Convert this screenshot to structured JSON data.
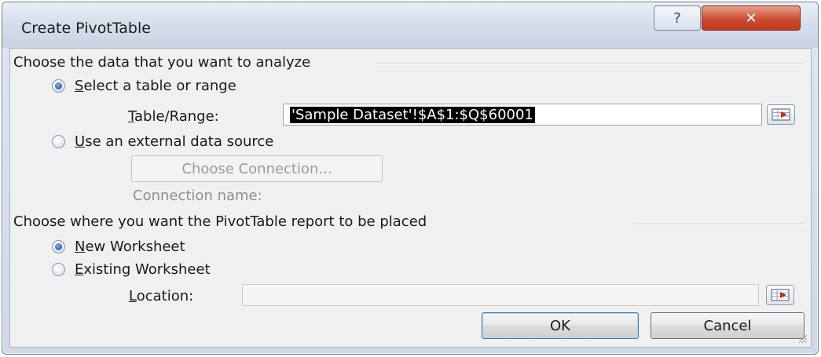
{
  "window": {
    "title": "Create PivotTable",
    "help_label": "?",
    "close_label": "✕"
  },
  "analyze_group": {
    "label": "Choose the data that you want to analyze",
    "select_table": {
      "label_accel": "S",
      "label_rest": "elect a table or range",
      "checked": true
    },
    "table_range": {
      "label_accel": "T",
      "label_rest": "able/Range:",
      "value": "'Sample Dataset'!$A$1:$Q$60001"
    },
    "external_source": {
      "label_accel": "U",
      "label_rest": "se an external data source",
      "checked": false
    },
    "choose_connection_label": "Choose Connection...",
    "connection_name_label": "Connection name:"
  },
  "placement_group": {
    "label": "Choose where you want the PivotTable report to be placed",
    "new_worksheet": {
      "label_accel": "N",
      "label_rest": "ew Worksheet",
      "checked": true
    },
    "existing_worksheet": {
      "label_accel": "E",
      "label_rest": "xisting Worksheet",
      "checked": false
    },
    "location": {
      "label_accel": "L",
      "label_rest": "ocation:",
      "value": ""
    }
  },
  "buttons": {
    "ok_label": "OK",
    "cancel_label": "Cancel"
  },
  "icons": {
    "help": "help-icon",
    "close": "close-icon",
    "range_select": "range-select-icon"
  },
  "colors": {
    "accent": "#2a63b8",
    "close_button": "#c23b22",
    "selection_background": "#000000"
  }
}
